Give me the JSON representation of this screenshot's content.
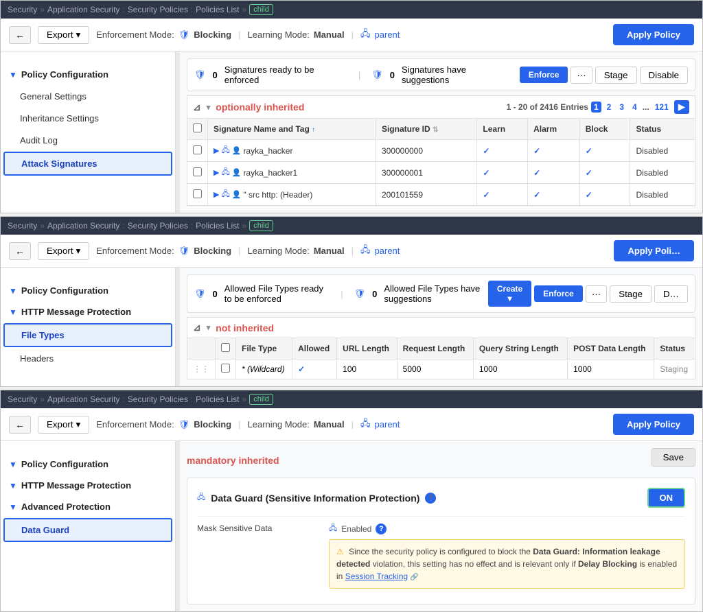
{
  "sections": [
    {
      "id": "attack-signatures",
      "breadcrumb": {
        "items": [
          "Security",
          "Application Security",
          "Security Policies",
          "Policies List"
        ],
        "active": "child"
      },
      "toolbar": {
        "back_label": "←",
        "export_label": "Export",
        "enforcement_mode_label": "Enforcement Mode:",
        "enforcement_mode_value": "Blocking",
        "learning_mode_label": "Learning Mode:",
        "learning_mode_value": "Manual",
        "parent_label": "parent",
        "apply_policy_label": "Apply Policy"
      },
      "sidebar": {
        "policy_config_label": "Policy Configuration",
        "items": [
          {
            "id": "general-settings",
            "label": "General Settings",
            "active": false
          },
          {
            "id": "inheritance-settings",
            "label": "Inheritance Settings",
            "active": false
          },
          {
            "id": "audit-log",
            "label": "Audit Log",
            "active": false
          },
          {
            "id": "attack-signatures",
            "label": "Attack Signatures",
            "active": true
          }
        ]
      },
      "content": {
        "summary": {
          "sig_ready_count": "0",
          "sig_ready_label": "Signatures ready to be enforced",
          "sig_suggest_count": "0",
          "sig_suggest_label": "Signatures have suggestions",
          "enforce_btn": "Enforce",
          "more_btn": "···",
          "stage_btn": "Stage",
          "disable_btn": "Disable"
        },
        "filter": {
          "icon": "⊿",
          "inherited_label": "optionally inherited",
          "page_info": "1 - 20 of 2416 Entries",
          "pages": [
            "1",
            "2",
            "3",
            "4",
            "...",
            "121"
          ]
        },
        "table": {
          "columns": [
            "",
            "Signature Name and Tag",
            "Signature ID",
            "Learn",
            "Alarm",
            "Block",
            "Status"
          ],
          "rows": [
            {
              "name": "rayka_hacker",
              "id": "300000000",
              "learn": true,
              "alarm": true,
              "block": true,
              "status": "Disabled"
            },
            {
              "name": "rayka_hacker1",
              "id": "300000001",
              "learn": true,
              "alarm": true,
              "block": true,
              "status": "Disabled"
            },
            {
              "name": "\" src http: (Header)",
              "id": "200101559",
              "learn": true,
              "alarm": true,
              "block": true,
              "status": "Disabled"
            }
          ]
        }
      }
    },
    {
      "id": "file-types",
      "breadcrumb": {
        "items": [
          "Security",
          "Application Security",
          "Security Policies",
          "Policies List"
        ],
        "active": "child"
      },
      "toolbar": {
        "back_label": "←",
        "export_label": "Export",
        "enforcement_mode_label": "Enforcement Mode:",
        "enforcement_mode_value": "Blocking",
        "learning_mode_label": "Learning Mode:",
        "learning_mode_value": "Manual",
        "parent_label": "parent",
        "apply_policy_label": "Apply Poli…"
      },
      "sidebar": {
        "policy_config_label": "Policy Configuration",
        "http_protection_label": "HTTP Message Protection",
        "items": [
          {
            "id": "file-types",
            "label": "File Types",
            "active": true
          },
          {
            "id": "headers",
            "label": "Headers",
            "active": false
          }
        ]
      },
      "content": {
        "summary": {
          "ft_ready_count": "0",
          "ft_ready_label": "Allowed File Types ready to be enforced",
          "ft_suggest_count": "0",
          "ft_suggest_label": "Allowed File Types have suggestions",
          "create_btn": "Create ▾",
          "enforce_btn": "Enforce",
          "more_btn": "···",
          "stage_btn": "Stage",
          "disable_btn": "D…"
        },
        "filter": {
          "inherited_label": "not inherited"
        },
        "table": {
          "columns": [
            "",
            "File Type",
            "Allowed",
            "URL Length",
            "Request Length",
            "Query String Length",
            "POST Data Length",
            "Status"
          ],
          "rows": [
            {
              "name": "* (Wildcard)",
              "allowed": true,
              "url_length": "100",
              "request_length": "5000",
              "query_string_length": "1000",
              "post_data_length": "1000",
              "status": "Staging"
            }
          ]
        }
      }
    },
    {
      "id": "data-guard",
      "breadcrumb": {
        "items": [
          "Security",
          "Application Security",
          "Security Policies",
          "Policies List"
        ],
        "active": "child"
      },
      "toolbar": {
        "back_label": "←",
        "export_label": "Export",
        "enforcement_mode_label": "Enforcement Mode:",
        "enforcement_mode_value": "Blocking",
        "learning_mode_label": "Learning Mode:",
        "learning_mode_value": "Manual",
        "parent_label": "parent",
        "apply_policy_label": "Apply Policy"
      },
      "sidebar": {
        "policy_config_label": "Policy Configuration",
        "http_protection_label": "HTTP Message Protection",
        "advanced_protection_label": "Advanced Protection",
        "items": [
          {
            "id": "data-guard",
            "label": "Data Guard",
            "active": true
          }
        ]
      },
      "content": {
        "inherited_label": "mandatory inherited",
        "save_btn": "Save",
        "card": {
          "title": "Data Guard (Sensitive Information Protection)",
          "toggle_label": "ON",
          "mask_label": "Mask Sensitive Data",
          "mask_value": "Enabled",
          "warning": "Since the security policy is configured to block the Data Guard: Information leakage detected violation, this setting has no effect and is relevant only if Delay Blocking is enabled in Session Tracking",
          "session_tracking_link": "Session Tracking"
        }
      }
    }
  ]
}
